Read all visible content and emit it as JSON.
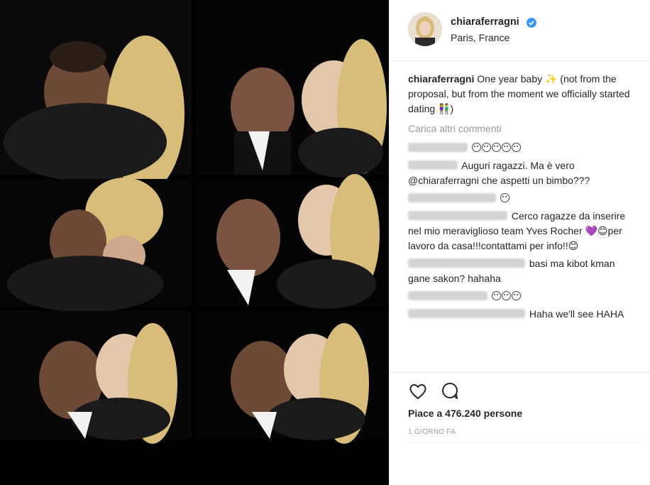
{
  "post": {
    "username": "chiaraferragni",
    "location": "Paris, France",
    "caption_user": "chiaraferragni",
    "caption_text": "One year baby ✨ (not from the proposal, but from the moment we officially started dating 👫)",
    "load_more": "Carica altri commenti",
    "likes": "Piace a 476.240 persone",
    "timestamp": "1 GIORNO FA"
  },
  "comments": [
    {
      "text": ""
    },
    {
      "text": "Auguri ragazzi. Ma è vero @chiaraferragni che aspetti un bimbo???"
    },
    {
      "text": ""
    },
    {
      "text": "Cerco ragazze da inserire nel mio meraviglioso team Yves Rocher 💜😊per lavoro da casa!!!contattami per info!!😊"
    },
    {
      "text": "basi ma kibot kman gane sakon? hahaha"
    },
    {
      "text": ""
    },
    {
      "text": "Haha we'll see HAHA"
    }
  ],
  "icons": {
    "verified": "verified-badge-icon",
    "like": "heart-icon",
    "comment": "comment-icon"
  },
  "colors": {
    "verified_blue": "#3897f0",
    "text": "#262626",
    "muted": "#999999",
    "photo_bg": "#000000"
  }
}
